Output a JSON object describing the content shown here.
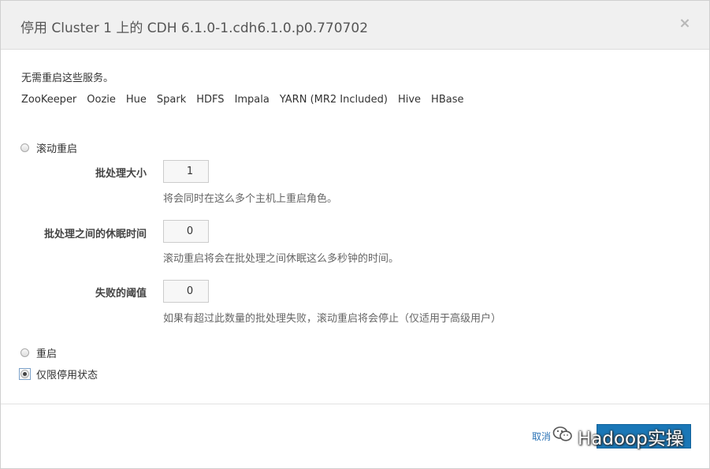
{
  "dialog": {
    "title": "停用 Cluster 1 上的 CDH 6.1.0-1.cdh6.1.0.p0.770702",
    "close": "×"
  },
  "no_restart_text": "无需重启这些服务。",
  "services": [
    "ZooKeeper",
    "Oozie",
    "Hue",
    "Spark",
    "HDFS",
    "Impala",
    "YARN (MR2 Included)",
    "Hive",
    "HBase"
  ],
  "options": {
    "rolling_restart": {
      "label": "滚动重启",
      "checked": false
    },
    "restart": {
      "label": "重启",
      "checked": false
    },
    "deactivate_only": {
      "label": "仅限停用状态",
      "checked": true
    }
  },
  "fields": {
    "batch_size": {
      "label": "批处理大小",
      "value": "1",
      "help": "将会同时在这么多个主机上重启角色。"
    },
    "sleep": {
      "label": "批处理之间的休眠时间",
      "value": "0",
      "help": "滚动重启将会在批处理之间休眠这么多秒钟的时间。"
    },
    "threshold": {
      "label": "失败的阈值",
      "value": "0",
      "help": "如果有超过此数量的批处理失败，滚动重启将会停止（仅适用于高级用户）"
    }
  },
  "footer": {
    "cancel": "取消",
    "confirm": ""
  },
  "watermark": {
    "text": "Hadoop实操",
    "icon": "wechat-icon"
  }
}
